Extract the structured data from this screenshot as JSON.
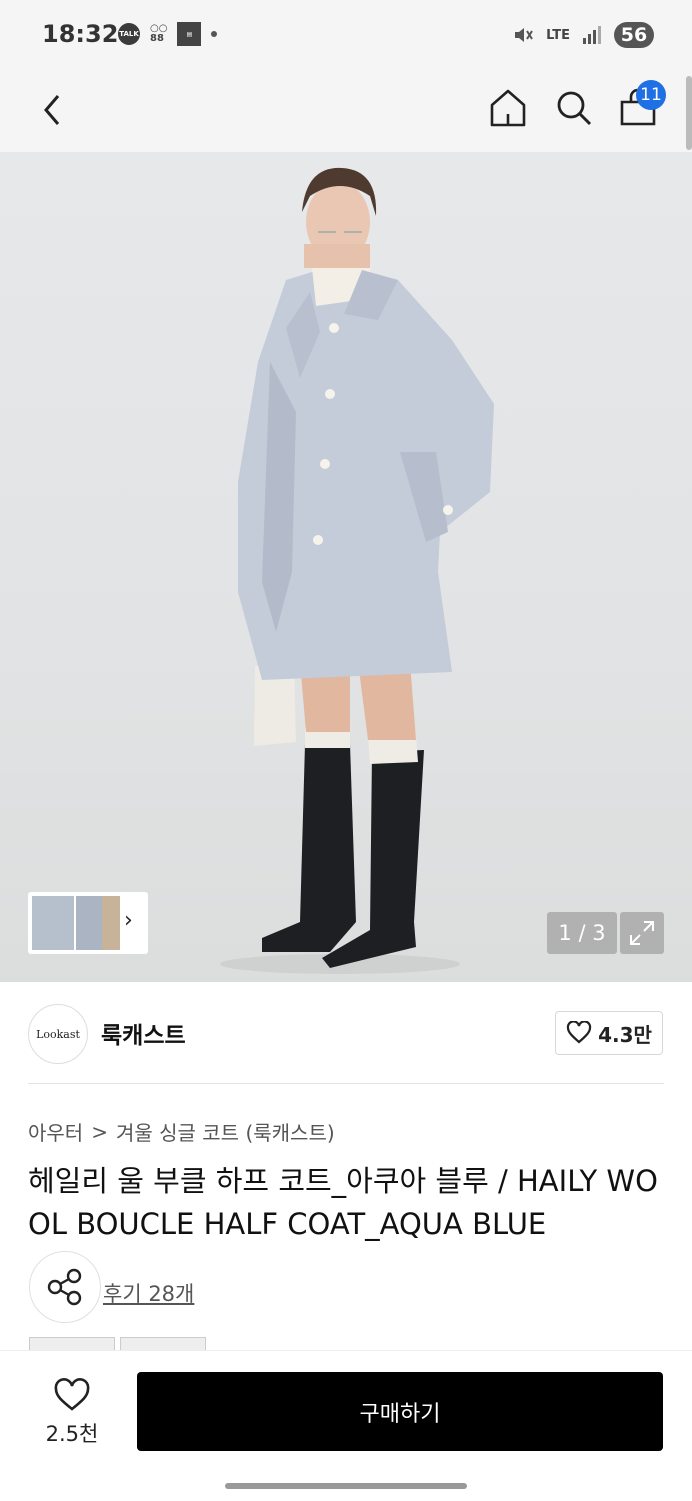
{
  "status_bar": {
    "time": "18:32",
    "talk_label": "TALK",
    "network": "LTE",
    "battery": "56"
  },
  "header": {
    "cart_count": "11"
  },
  "gallery": {
    "counter": "1 / 3"
  },
  "brand": {
    "logo_text": "Lookast",
    "name": "룩캐스트",
    "likes": "4.3만"
  },
  "breadcrumb": {
    "category": "아우터",
    "separator": ">",
    "subcategory": "겨울 싱글 코트 (룩캐스트)"
  },
  "product": {
    "title": "헤일리 울 부클 하프 코트_아쿠아 블루 / HAILY WOOL BOUCLE HALF COAT_AQUA BLUE",
    "reviews": "후기 28개"
  },
  "bottom_bar": {
    "wish_count": "2.5천",
    "buy_label": "구매하기"
  },
  "colors": {
    "accent": "#1f6fe5",
    "buy_button": "#000000",
    "coat": "#c4cbd9"
  }
}
